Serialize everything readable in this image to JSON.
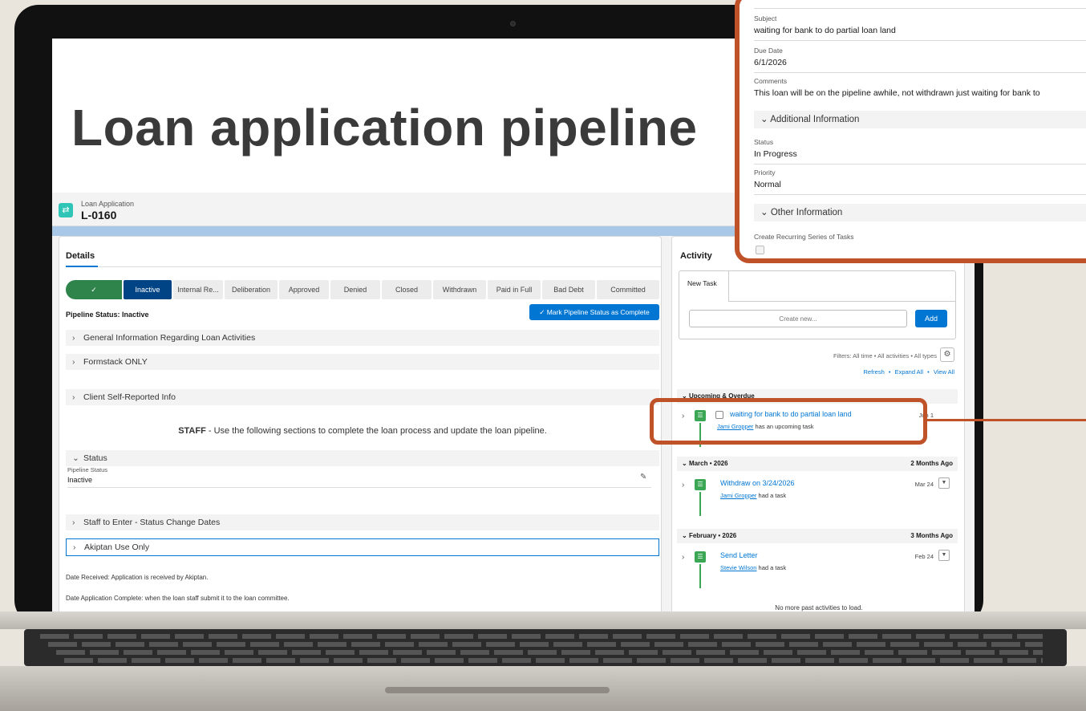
{
  "hero": {
    "title": "Loan application pipeline"
  },
  "record": {
    "type": "Loan Application",
    "name": "L-0160"
  },
  "details": {
    "title": "Details",
    "path_steps": [
      {
        "label": "✓",
        "state": "done"
      },
      {
        "label": "Inactive",
        "state": "current"
      },
      {
        "label": "Internal Re...",
        "state": "todo"
      },
      {
        "label": "Deliberation",
        "state": "todo"
      },
      {
        "label": "Approved",
        "state": "todo"
      },
      {
        "label": "Denied",
        "state": "todo"
      },
      {
        "label": "Closed",
        "state": "todo"
      },
      {
        "label": "Withdrawn",
        "state": "todo"
      },
      {
        "label": "Paid in Full",
        "state": "todo"
      },
      {
        "label": "Bad Debt",
        "state": "todo"
      },
      {
        "label": "Committed",
        "state": "todo"
      }
    ],
    "pipeline_status_label": "Pipeline Status: Inactive",
    "mark_button": "Mark Pipeline Status as Complete",
    "sections": {
      "general": "General Information Regarding Loan Activities",
      "formstack": "Formstack ONLY",
      "client": "Client Self-Reported Info",
      "status": "Status",
      "staff_dates": "Staff to Enter - Status Change Dates",
      "akiptan": "Akiptan Use Only"
    },
    "staff_note_bold": "STAFF",
    "staff_note_rest": " - Use the following sections to complete the loan process and update the loan pipeline.",
    "field": {
      "label": "Pipeline Status",
      "value": "Inactive"
    },
    "notes": [
      "Date Received: Application is received by Akiptan.",
      "Date Application Complete: when the loan staff submit it to the loan committee."
    ]
  },
  "activity": {
    "title": "Activity",
    "tab": "New Task",
    "create_placeholder": "Create new...",
    "add_button": "Add",
    "filters": "Filters: All time • All activities • All types",
    "links": {
      "refresh": "Refresh",
      "expand": "Expand All",
      "view": "View All",
      "sep": "•"
    },
    "groups": {
      "upcoming": {
        "label": "Upcoming & Overdue"
      },
      "march": {
        "label": "March • 2026",
        "ago": "2 Months Ago"
      },
      "february": {
        "label": "February • 2026",
        "ago": "3 Months Ago"
      }
    },
    "items": [
      {
        "title": "waiting for bank to do partial loan land",
        "person": "Jami Gropper",
        "suffix": "has an upcoming task",
        "date": "Jun 1"
      },
      {
        "title": "Withdraw on 3/24/2026",
        "person": "Jami Gropper",
        "suffix": "had a task",
        "date": "Mar 24"
      },
      {
        "title": "Send Letter",
        "person": "Stevie Wilson",
        "suffix": "had a task",
        "date": "Feb 24"
      }
    ],
    "no_more": "No more past activities to load."
  },
  "callout": {
    "subject_label": "Subject",
    "subject_value": "waiting for bank to do partial loan land",
    "due_label": "Due Date",
    "due_value": "6/1/2026",
    "comments_label": "Comments",
    "comments_value": "This loan will be on the pipeline awhile, not withdrawn just waiting for bank to",
    "additional_section": "Additional Information",
    "status_label": "Status",
    "status_value": "In Progress",
    "priority_label": "Priority",
    "priority_value": "Normal",
    "other_section": "Other Information",
    "recurring_label": "Create Recurring Series of Tasks"
  },
  "colors": {
    "accent": "#c0522a",
    "brand": "#0176d3",
    "success": "#2e844a",
    "current": "#014486"
  }
}
